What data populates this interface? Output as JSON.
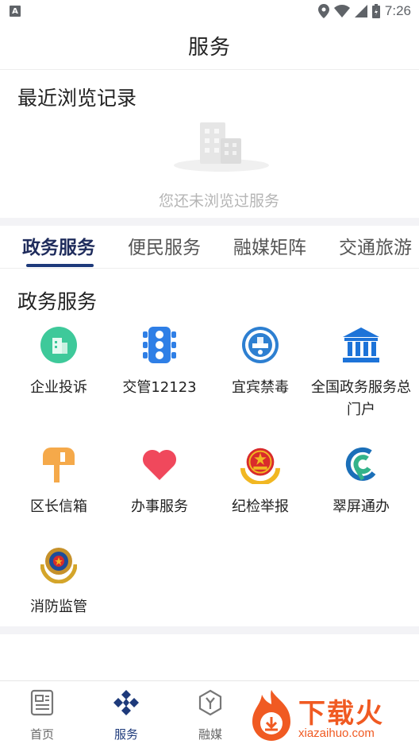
{
  "status_bar": {
    "time": "7:26",
    "icons": [
      "notification-a-icon",
      "location-icon",
      "wifi-icon",
      "signal-icon",
      "battery-icon"
    ]
  },
  "header": {
    "title": "服务"
  },
  "recent": {
    "title": "最近浏览记录",
    "empty_text": "您还未浏览过服务"
  },
  "tabs": [
    {
      "label": "政务服务",
      "active": true
    },
    {
      "label": "便民服务",
      "active": false
    },
    {
      "label": "融媒矩阵",
      "active": false
    },
    {
      "label": "交通旅游",
      "active": false
    }
  ],
  "section": {
    "title": "政务服务",
    "items": [
      {
        "label": "企业投诉",
        "icon": "building-icon"
      },
      {
        "label": "交管12123",
        "icon": "traffic-light-icon"
      },
      {
        "label": "宜宾禁毒",
        "icon": "anti-drug-emblem-icon"
      },
      {
        "label": "全国政务服务总门户",
        "icon": "government-building-icon"
      },
      {
        "label": "区长信箱",
        "icon": "mailbox-icon"
      },
      {
        "label": "办事服务",
        "icon": "heart-icon"
      },
      {
        "label": "纪检举报",
        "icon": "national-emblem-icon"
      },
      {
        "label": "翠屏通办",
        "icon": "cuiping-logo-icon"
      },
      {
        "label": "消防监管",
        "icon": "fire-emblem-icon"
      }
    ]
  },
  "bottom_nav": [
    {
      "label": "首页",
      "icon": "newspaper-icon",
      "active": false
    },
    {
      "label": "服务",
      "icon": "diamond-grid-icon",
      "active": true
    },
    {
      "label": "融媒",
      "icon": "hexagon-y-icon",
      "active": false
    }
  ],
  "watermark": {
    "title": "下载火",
    "url": "xiazaihuo.com"
  },
  "colors": {
    "accent": "#1e3a7b",
    "separator": "#f3f3f6",
    "empty_text": "#b5b5b5",
    "watermark": "#f05a22"
  }
}
